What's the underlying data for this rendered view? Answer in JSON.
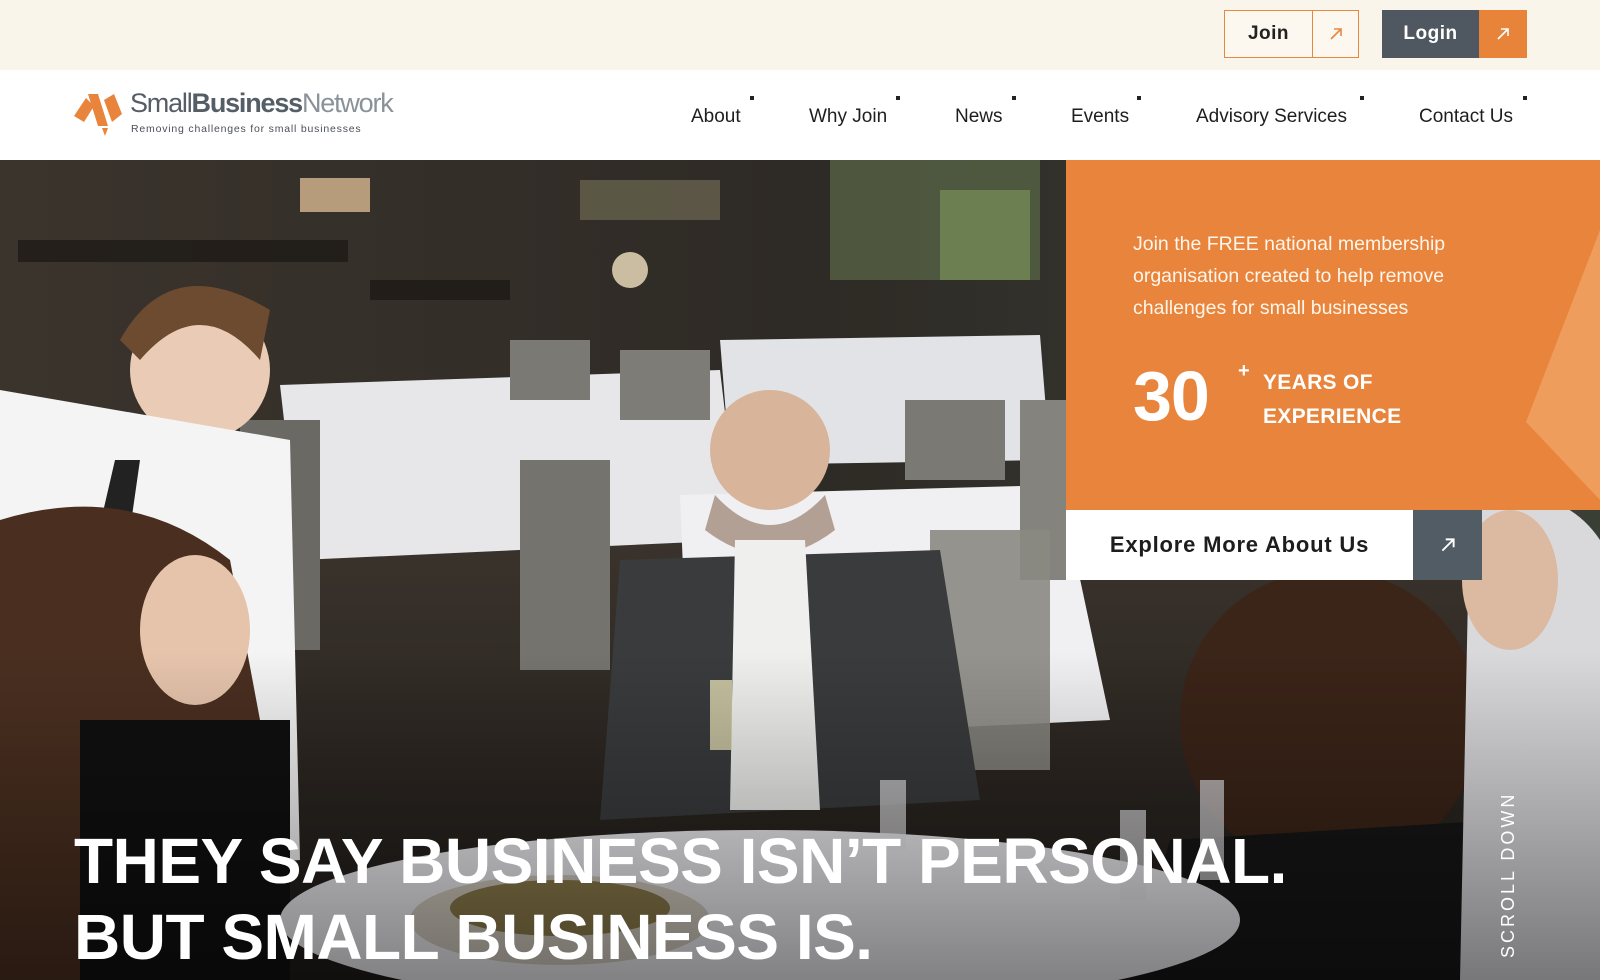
{
  "topbar": {
    "join_label": "Join",
    "login_label": "Login",
    "arrow_icon": "arrow-up-right-icon"
  },
  "logo": {
    "word_small": "Small",
    "word_business": "Business",
    "word_network": "Network",
    "tagline": "Removing challenges for small businesses",
    "icon": "logo-mark-icon"
  },
  "nav": {
    "items": [
      "About",
      "Why Join",
      "News",
      "Events",
      "Advisory Services",
      "Contact Us"
    ]
  },
  "hero": {
    "panel_text": "Join the FREE national membership organisation created to help remove challenges for small businesses",
    "stat_number": "30",
    "stat_plus": "+",
    "stat_line1": "YEARS OF",
    "stat_line2": "EXPERIENCE",
    "cta_label": "Explore More About Us",
    "headline_line1": "THEY SAY BUSINESS ISN’T PERSONAL.",
    "headline_line2": "BUT SMALL BUSINESS IS.",
    "scroll_label": "SCROLL DOWN"
  },
  "colors": {
    "accent_orange": "#e8843b",
    "slate": "#4f5860",
    "topbar_bg": "#faf5ea"
  }
}
